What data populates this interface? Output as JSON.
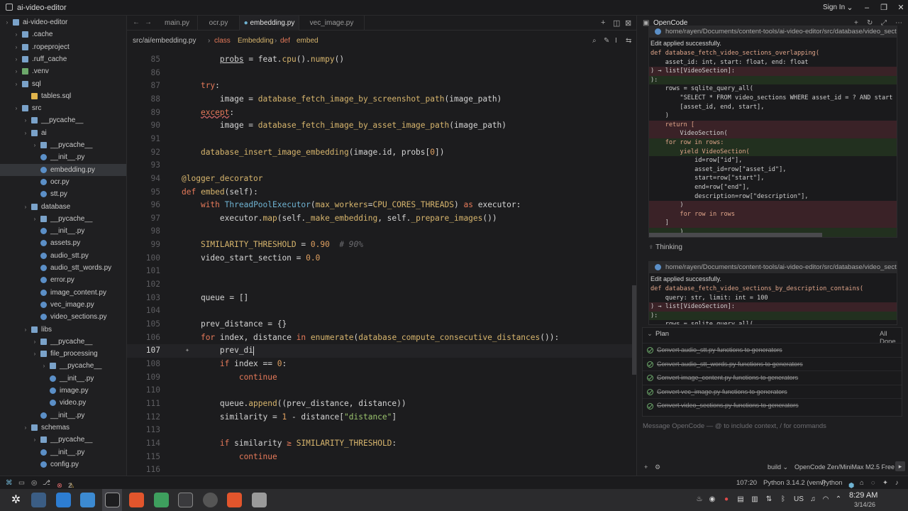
{
  "window": {
    "title": "ai-video-editor",
    "sign_in": "Sign In"
  },
  "explorer": {
    "items": [
      {
        "label": "ai-video-editor",
        "icon": "folder-open-icon",
        "depth": 0
      },
      {
        "label": ".cache",
        "icon": "folder-icon",
        "depth": 1
      },
      {
        "label": ".ropeproject",
        "icon": "folder-icon",
        "depth": 1
      },
      {
        "label": ".ruff_cache",
        "icon": "folder-icon",
        "depth": 1
      },
      {
        "label": ".venv",
        "icon": "venv-folder-icon",
        "depth": 1
      },
      {
        "label": "sql",
        "icon": "folder-icon",
        "depth": 1
      },
      {
        "label": "tables.sql",
        "icon": "sql-file-icon",
        "depth": 2
      },
      {
        "label": "src",
        "icon": "folder-icon",
        "depth": 1
      },
      {
        "label": "__pycache__",
        "icon": "folder-icon",
        "depth": 2
      },
      {
        "label": "ai",
        "icon": "folder-icon",
        "depth": 2
      },
      {
        "label": "__pycache__",
        "icon": "folder-icon",
        "depth": 3
      },
      {
        "label": "__init__.py",
        "icon": "python-file-icon",
        "depth": 3
      },
      {
        "label": "embedding.py",
        "icon": "python-file-icon",
        "depth": 3
      },
      {
        "label": "ocr.py",
        "icon": "python-file-icon",
        "depth": 3
      },
      {
        "label": "stt.py",
        "icon": "python-file-icon",
        "depth": 3
      },
      {
        "label": "database",
        "icon": "folder-icon",
        "depth": 2
      },
      {
        "label": "__pycache__",
        "icon": "folder-icon",
        "depth": 3
      },
      {
        "label": "__init__.py",
        "icon": "python-file-icon",
        "depth": 3
      },
      {
        "label": "assets.py",
        "icon": "python-file-icon",
        "depth": 3
      },
      {
        "label": "audio_stt.py",
        "icon": "python-file-icon",
        "depth": 3
      },
      {
        "label": "audio_stt_words.py",
        "icon": "python-file-icon",
        "depth": 3
      },
      {
        "label": "error.py",
        "icon": "python-file-icon",
        "depth": 3
      },
      {
        "label": "image_content.py",
        "icon": "python-file-icon",
        "depth": 3
      },
      {
        "label": "vec_image.py",
        "icon": "python-file-icon",
        "depth": 3
      },
      {
        "label": "video_sections.py",
        "icon": "python-file-icon",
        "depth": 3
      },
      {
        "label": "libs",
        "icon": "folder-icon",
        "depth": 2
      },
      {
        "label": "__pycache__",
        "icon": "folder-icon",
        "depth": 3
      },
      {
        "label": "file_processing",
        "icon": "folder-icon",
        "depth": 3
      },
      {
        "label": "__pycache__",
        "icon": "folder-icon",
        "depth": 4
      },
      {
        "label": "__init__.py",
        "icon": "python-file-icon",
        "depth": 4
      },
      {
        "label": "image.py",
        "icon": "python-file-icon",
        "depth": 4
      },
      {
        "label": "video.py",
        "icon": "python-file-icon",
        "depth": 4
      },
      {
        "label": "__init__.py",
        "icon": "python-file-icon",
        "depth": 3
      },
      {
        "label": "schemas",
        "icon": "folder-icon",
        "depth": 2
      },
      {
        "label": "__pycache__",
        "icon": "folder-icon",
        "depth": 3
      },
      {
        "label": "__init__.py",
        "icon": "python-file-icon",
        "depth": 3
      },
      {
        "label": "config.py",
        "icon": "python-file-icon",
        "depth": 3
      }
    ]
  },
  "tabs": [
    {
      "label": "main.py",
      "active": false
    },
    {
      "label": "ocr.py",
      "active": false
    },
    {
      "label": "embedding.py",
      "active": true
    },
    {
      "label": "vec_image.py",
      "active": false
    }
  ],
  "breadcrumb": {
    "path": "src/ai/embedding.py",
    "class_kw": "class",
    "class_name": "Embedding",
    "def_kw": "def",
    "fn_name": "embed"
  },
  "editor": {
    "current_line": 107,
    "lines": [
      {
        "n": "85",
        "html": "        <span class=\"var\" style=\"text-decoration:underline\">probs</span> = feat.<span class=\"fn\">cpu</span>().<span class=\"fn\">numpy</span>()"
      },
      {
        "n": "86",
        "html": ""
      },
      {
        "n": "87",
        "html": "    <span class=\"kw\">try</span>:"
      },
      {
        "n": "88",
        "html": "        image = <span class=\"fn\">database_fetch_image_by_screenshot_path</span>(image_path)"
      },
      {
        "n": "89",
        "html": "    <span class=\"kw\" style=\"text-decoration:underline wavy #e06c6c\">except</span>:"
      },
      {
        "n": "90",
        "html": "        image = <span class=\"fn\">database_fetch_image_by_asset_image_path</span>(image_path)"
      },
      {
        "n": "91",
        "html": ""
      },
      {
        "n": "92",
        "html": "    <span class=\"fn\">database_insert_image_embedding</span>(image.id, probs[<span class=\"num\">0</span>])"
      },
      {
        "n": "93",
        "html": ""
      },
      {
        "n": "94",
        "html": "<span class=\"dec\">@logger_decorator</span>"
      },
      {
        "n": "95",
        "html": "<span class=\"kw\">def</span> <span class=\"fn\">embed</span>(self):"
      },
      {
        "n": "96",
        "html": "    <span class=\"kw\">with</span> <span class=\"cls\">ThreadPoolExecutor</span>(<span class=\"fn\">max_workers</span>=<span class=\"fn\">CPU_CORES_THREADS</span>) <span class=\"kw\">as</span> executor:"
      },
      {
        "n": "97",
        "html": "        executor.<span class=\"fn\">map</span>(self.<span class=\"fn\">_make_embedding</span>, self.<span class=\"fn\">_prepare_images</span>())"
      },
      {
        "n": "98",
        "html": ""
      },
      {
        "n": "99",
        "html": "    <span class=\"fn\">SIMILARITY_THRESHOLD</span> = <span class=\"num\">0.90</span>  <span class=\"cmt\"># 90%</span>"
      },
      {
        "n": "100",
        "html": "    video_start_section = <span class=\"num\">0.0</span>"
      },
      {
        "n": "101",
        "html": ""
      },
      {
        "n": "102",
        "html": ""
      },
      {
        "n": "103",
        "html": "    queue = []"
      },
      {
        "n": "104",
        "html": ""
      },
      {
        "n": "105",
        "html": "    prev_distance = {}"
      },
      {
        "n": "106",
        "html": "    <span class=\"kw\">for</span> index, distance <span class=\"kw\">in</span> <span class=\"fn\">enumerate</span>(<span class=\"fn\">database_compute_consecutive_distances</span>()):"
      },
      {
        "n": "107",
        "html": "        prev_di<span class=\"cursor\"></span>"
      },
      {
        "n": "108",
        "html": "        <span class=\"kw\">if</span> index == <span class=\"num\">0</span>:"
      },
      {
        "n": "109",
        "html": "            <span class=\"kw\">continue</span>"
      },
      {
        "n": "110",
        "html": ""
      },
      {
        "n": "111",
        "html": "        queue.<span class=\"fn\">append</span>((prev_distance, distance))"
      },
      {
        "n": "112",
        "html": "        similarity = <span class=\"num\">1</span> - distance[<span class=\"str\">\"distance\"</span>]"
      },
      {
        "n": "113",
        "html": ""
      },
      {
        "n": "114",
        "html": "        <span class=\"kw\">if</span> similarity <span class=\"kw\">≥</span> <span class=\"fn\">SIMILARITY_THRESHOLD</span>:"
      },
      {
        "n": "115",
        "html": "            <span class=\"kw\">continue</span>"
      },
      {
        "n": "116",
        "html": ""
      }
    ]
  },
  "opencode": {
    "title": "OpenCode",
    "diff1": {
      "path": "home/rayen/Documents/content-tools/ai-video-editor/src/database/video_sections",
      "status": "Edit applied successfully.",
      "lines": [
        {
          "k": "",
          "t": "def database_fetch_video_sections_overlapping("
        },
        {
          "k": "",
          "t": "    asset_id: int, start: float, end: float"
        },
        {
          "k": "del",
          "t": ") → list[VideoSection]:"
        },
        {
          "k": "add",
          "t": "):"
        },
        {
          "k": "",
          "t": "    rows = sqlite_query_all("
        },
        {
          "k": "",
          "t": "        \"SELECT * FROM video_sections WHERE asset_id = ? AND start < ? AND"
        },
        {
          "k": "",
          "t": "        [asset_id, end, start],"
        },
        {
          "k": "",
          "t": "    )"
        },
        {
          "k": "del",
          "t": "    return ["
        },
        {
          "k": "del",
          "t": "        VideoSection("
        },
        {
          "k": "add",
          "t": "    for row in rows:"
        },
        {
          "k": "add",
          "t": "        yield VideoSection("
        },
        {
          "k": "",
          "t": "            id=row[\"id\"],"
        },
        {
          "k": "",
          "t": "            asset_id=row[\"asset_id\"],"
        },
        {
          "k": "",
          "t": "            start=row[\"start\"],"
        },
        {
          "k": "",
          "t": "            end=row[\"end\"],"
        },
        {
          "k": "",
          "t": "            description=row[\"description\"],"
        },
        {
          "k": "del",
          "t": "        )"
        },
        {
          "k": "del",
          "t": "        for row in rows"
        },
        {
          "k": "del",
          "t": "    ]"
        },
        {
          "k": "add",
          "t": "        )"
        }
      ]
    },
    "thinking_label": "Thinking",
    "diff2": {
      "path": "home/rayen/Documents/content-tools/ai-video-editor/src/database/video_sections",
      "status": "Edit applied successfully.",
      "lines": [
        {
          "k": "",
          "t": "def database_fetch_video_sections_by_description_contains("
        },
        {
          "k": "",
          "t": "    query: str, limit: int = 100"
        },
        {
          "k": "del",
          "t": ") → list[VideoSection]:"
        },
        {
          "k": "add",
          "t": "):"
        },
        {
          "k": "",
          "t": "    rows = sqlite_query_all("
        }
      ]
    },
    "plan": {
      "title": "Plan",
      "status": "All Done",
      "items": [
        "Convert audio_stt.py functions to generators",
        "Convert audio_stt_words.py functions to generators",
        "Convert image_content.py functions to generators",
        "Convert vec_image.py functions to generators",
        "Convert video_sections.py functions to generators"
      ]
    },
    "input_placeholder": "Message OpenCode — @ to include context, / for commands",
    "mode": "build",
    "model": "OpenCode Zen/MiniMax M2.5 Free"
  },
  "statusbar": {
    "warnings": "2",
    "position": "107:20",
    "interpreter": "Python 3.14.2 (venv)",
    "language": "Python",
    "lang2": "Python"
  },
  "taskbar": {
    "time": "8:29 AM",
    "date": "3/14/26",
    "lang": "US"
  },
  "colors": {
    "accent": "#6fb3d2",
    "keyword": "#e67a5a",
    "function": "#d7b56d",
    "deleted_bg": "#3a2227",
    "added_bg": "#22301f"
  }
}
